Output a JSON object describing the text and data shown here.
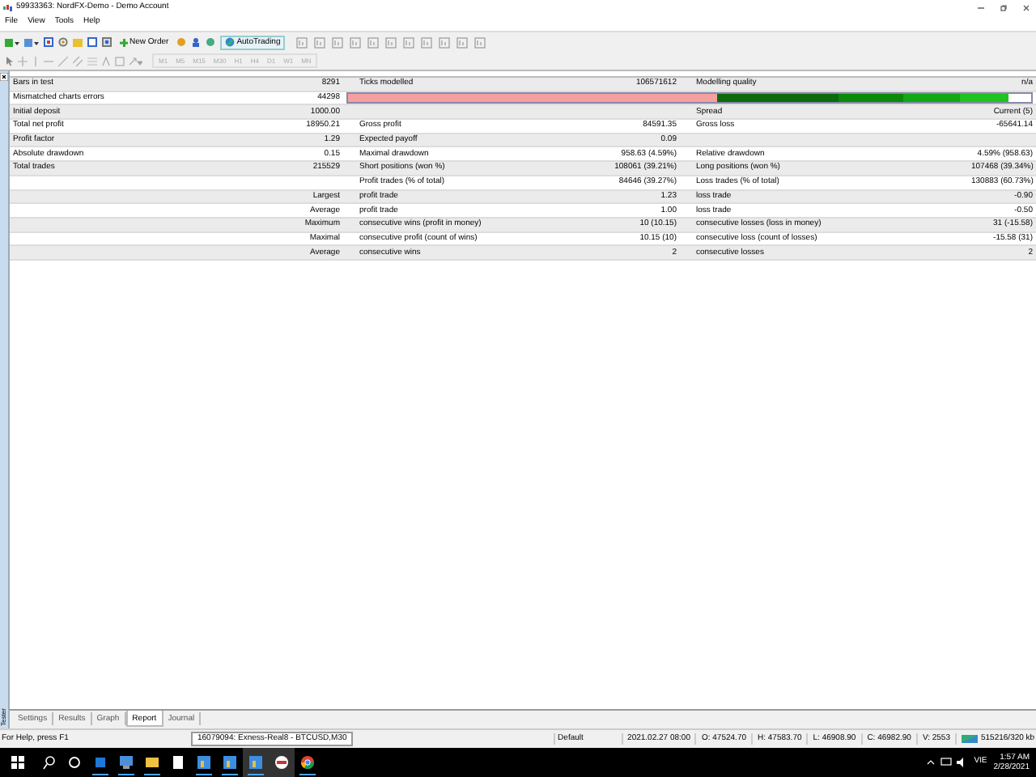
{
  "window": {
    "title": "59933363: NordFX-Demo - Demo Account"
  },
  "menu": [
    "File",
    "View",
    "Tools",
    "Help"
  ],
  "toolbar": {
    "new_order": "New Order",
    "autotrading": "AutoTrading"
  },
  "timeframes": [
    {
      "label": "M1",
      "disabled": true
    },
    {
      "label": "M5",
      "disabled": true
    },
    {
      "label": "M15",
      "disabled": true
    },
    {
      "label": "M30",
      "disabled": true
    },
    {
      "label": "H1",
      "disabled": true
    },
    {
      "label": "H4",
      "disabled": true
    },
    {
      "label": "D1",
      "disabled": true
    },
    {
      "label": "W1",
      "disabled": true
    },
    {
      "label": "MN",
      "disabled": true
    }
  ],
  "report": {
    "rows": [
      {
        "cells": [
          "Bars in test",
          "8291",
          "Ticks modelled",
          "106571612",
          "Modelling quality",
          "n/a"
        ]
      },
      {
        "cells": [
          "Mismatched charts errors",
          "44298"
        ],
        "kind": "quality"
      },
      {
        "cells": [
          "Initial deposit",
          "1000.00",
          "",
          "",
          "Spread",
          "Current (5)"
        ]
      },
      {
        "cells": [
          "Total net profit",
          "18950.21",
          "Gross profit",
          "84591.35",
          "Gross loss",
          "-65641.14"
        ]
      },
      {
        "cells": [
          "Profit factor",
          "1.29",
          "Expected payoff",
          "0.09",
          "",
          ""
        ]
      },
      {
        "cells": [
          "Absolute drawdown",
          "0.15",
          "Maximal drawdown",
          "958.63 (4.59%)",
          "Relative drawdown",
          "4.59% (958.63)"
        ]
      },
      {
        "cells": [
          "Total trades",
          "215529",
          "Short positions (won %)",
          "108061 (39.21%)",
          "Long positions (won %)",
          "107468 (39.34%)"
        ]
      },
      {
        "cells": [
          "",
          "",
          "Profit trades (% of total)",
          "84646 (39.27%)",
          "Loss trades (% of total)",
          "130883 (60.73%)"
        ]
      },
      {
        "cells": [
          "",
          "Largest",
          "profit trade",
          "1.23",
          "loss trade",
          "-0.90"
        ]
      },
      {
        "cells": [
          "",
          "Average",
          "profit trade",
          "1.00",
          "loss trade",
          "-0.50"
        ]
      },
      {
        "cells": [
          "",
          "Maximum",
          "consecutive wins (profit in money)",
          "10 (10.15)",
          "consecutive losses (loss in money)",
          "31 (-15.58)"
        ]
      },
      {
        "cells": [
          "",
          "Maximal",
          "consecutive profit (count of wins)",
          "10.15 (10)",
          "consecutive loss (count of losses)",
          "-15.58 (31)"
        ]
      },
      {
        "cells": [
          "",
          "Average",
          "consecutive wins",
          "2",
          "consecutive losses",
          "2"
        ]
      }
    ]
  },
  "panel_label": "Tester",
  "tabs": [
    {
      "label": "Settings",
      "selected": false
    },
    {
      "label": "Results",
      "selected": false
    },
    {
      "label": "Graph",
      "selected": false
    },
    {
      "label": "Report",
      "selected": true
    },
    {
      "label": "Journal",
      "selected": false
    }
  ],
  "status_bar": {
    "help": "For Help, press F1",
    "tooltip": "16079094: Exness-Real8 - BTCUSD,M30",
    "profile": "Default",
    "fields": [
      "2021.02.27 08:00",
      "O: 47524.70",
      "H: 47583.70",
      "L: 46908.90",
      "C: 46982.90",
      "V: 2553"
    ],
    "traffic": "515216/320 kb"
  },
  "taskbar": {
    "language": "VIE",
    "time": "1:57 AM",
    "date": "2/28/2021"
  }
}
